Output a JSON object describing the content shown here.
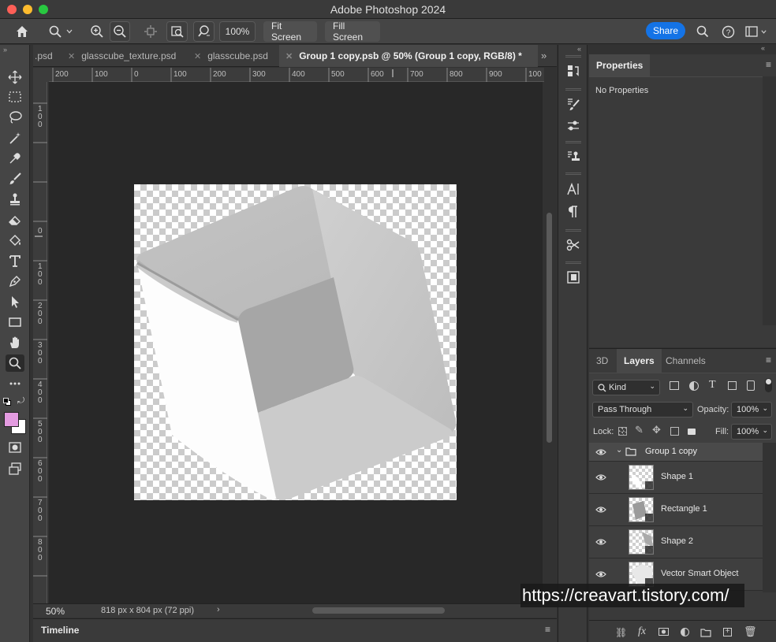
{
  "app": {
    "title": "Adobe Photoshop 2024"
  },
  "options_bar": {
    "zoom_value": "100%",
    "fit_screen": "Fit Screen",
    "fill_screen": "Fill Screen",
    "share": "Share"
  },
  "tabs": [
    {
      "label": ".psd"
    },
    {
      "label": "glasscube_texture.psd"
    },
    {
      "label": "glasscube.psd"
    },
    {
      "label": "Group 1 copy.psb @ 50% (Group 1 copy, RGB/8) *"
    }
  ],
  "ruler": {
    "h_labels": [
      "200",
      "100",
      "0",
      "100",
      "200",
      "300",
      "400",
      "500",
      "600",
      "700",
      "800",
      "900",
      "100"
    ],
    "v_labels": [
      "1\n0\n0",
      "0",
      "1\n0\n0",
      "2\n0\n0",
      "3\n0\n0",
      "4\n0\n0",
      "5\n0\n0",
      "6\n0\n0",
      "7\n0\n0",
      "8\n0\n0"
    ]
  },
  "status": {
    "zoom": "50%",
    "doc_info": "818 px x 804 px (72 ppi)"
  },
  "timeline": {
    "label": "Timeline"
  },
  "properties": {
    "tab": "Properties",
    "empty_text": "No Properties"
  },
  "layers_panel": {
    "tabs": [
      "3D",
      "Layers",
      "Channels"
    ],
    "kind": "Kind",
    "blend_mode": "Pass Through",
    "opacity_label": "Opacity:",
    "opacity_value": "100%",
    "lock_label": "Lock:",
    "fill_label": "Fill:",
    "fill_value": "100%",
    "layers": [
      {
        "name": "Group 1 copy",
        "type": "group"
      },
      {
        "name": "Shape 1",
        "type": "shape"
      },
      {
        "name": "Rectangle 1",
        "type": "shape"
      },
      {
        "name": "Shape 2",
        "type": "shape"
      },
      {
        "name": "Vector Smart Object",
        "type": "smart-object"
      }
    ]
  },
  "watermark": {
    "text": "https://creavart.tistory.com/"
  },
  "colors": {
    "foreground": "#e39be0",
    "background": "#ffffff",
    "accent": "#1473e6"
  }
}
